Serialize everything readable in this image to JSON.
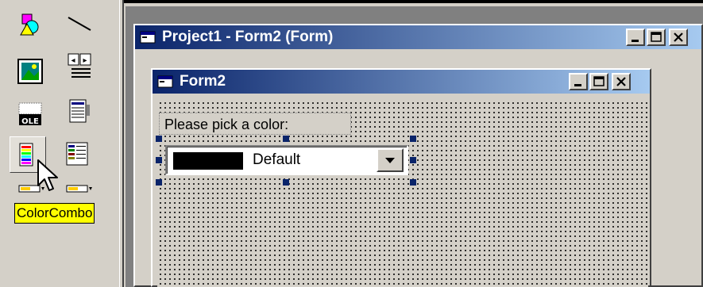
{
  "outer_window": {
    "title": "Project1 - Form2 (Form)",
    "icon": "form-icon",
    "controls": [
      "minimize-icon",
      "maximize-icon",
      "close-icon"
    ]
  },
  "form_window": {
    "title": "Form2",
    "icon": "form-icon",
    "controls": [
      "minimize-icon",
      "maximize-icon",
      "close-icon"
    ]
  },
  "form": {
    "label_text": "Please pick a color:",
    "combo": {
      "selected_color_name": "Default",
      "selected_swatch_color": "#000000",
      "dropdown_icon": "arrow-down-icon"
    }
  },
  "toolbox": {
    "tools": [
      {
        "name": "shape-tool",
        "icon": "shapes-icon"
      },
      {
        "name": "line-tool",
        "icon": "line-icon"
      },
      {
        "name": "image-tool",
        "icon": "picture-icon"
      },
      {
        "name": "data-tool",
        "icon": "data-control-icon"
      },
      {
        "name": "ole-tool",
        "icon": "ole-icon"
      },
      {
        "name": "list-tool",
        "icon": "listbox-icon"
      },
      {
        "name": "colorcombo-tool",
        "icon": "color-combo-icon",
        "selected": true
      },
      {
        "name": "color-list-tool",
        "icon": "color-list-icon"
      },
      {
        "name": "extra-tool-1",
        "icon": "combo-small-icon"
      },
      {
        "name": "extra-tool-2",
        "icon": "combo-small-icon"
      }
    ],
    "tooltip": "ColorCombo"
  },
  "colors": {
    "titlebar_start": "#0a246a",
    "titlebar_end": "#a6caf0",
    "face": "#d4d0c8",
    "tooltip_bg": "#ffff00",
    "mdi_bg": "#808080",
    "handle": "#0a246a"
  }
}
